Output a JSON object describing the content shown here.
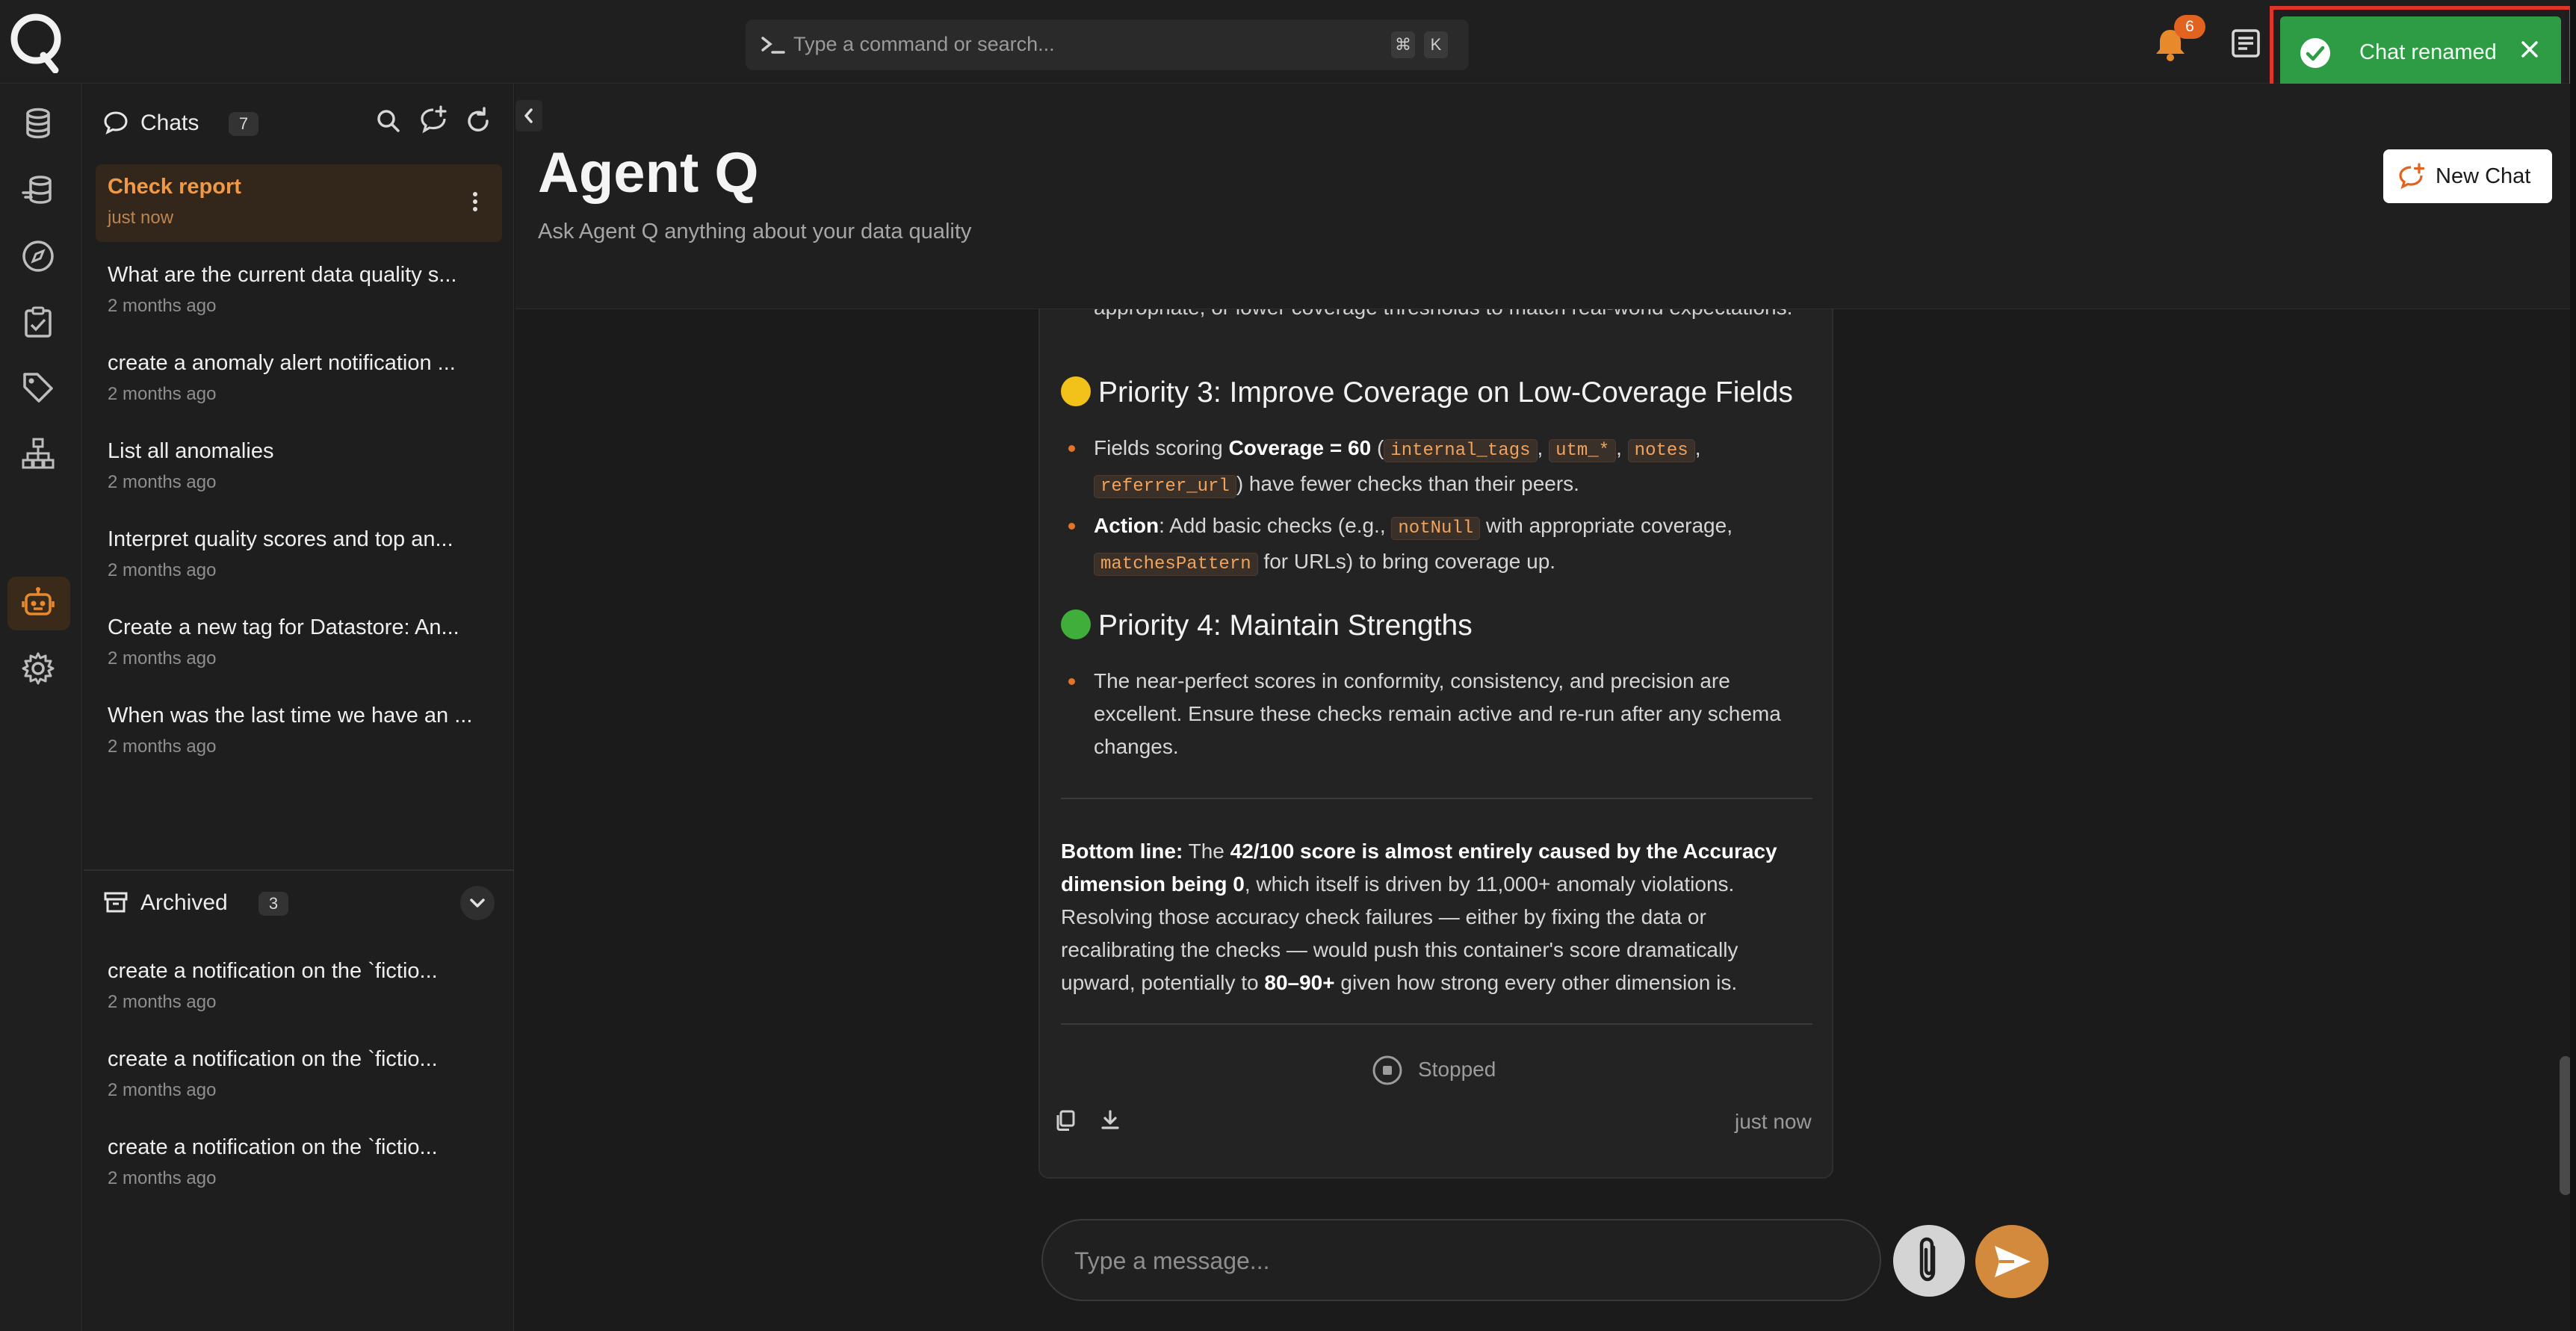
{
  "command_bar": {
    "placeholder": "Type a command or search...",
    "shortcut_mod": "⌘",
    "shortcut_key": "K"
  },
  "notifications": {
    "count": "6"
  },
  "toast": {
    "message": "Chat renamed",
    "color": "#2e9c45"
  },
  "sidebar_rail": {
    "items": [
      "database-icon",
      "datastore-icon",
      "explore-icon",
      "checks-icon",
      "tags-icon",
      "lineage-icon",
      "agent-icon",
      "settings-icon"
    ],
    "active": "agent-icon"
  },
  "chats": {
    "title": "Chats",
    "count": "7",
    "items": [
      {
        "title": "Check report",
        "time": "just now"
      },
      {
        "title": "What are the current data quality s...",
        "time": "2 months ago"
      },
      {
        "title": "create a anomaly alert notification ...",
        "time": "2 months ago"
      },
      {
        "title": "List all anomalies",
        "time": "2 months ago"
      },
      {
        "title": "Interpret quality scores and top an...",
        "time": "2 months ago"
      },
      {
        "title": "Create a new tag for Datastore: An...",
        "time": "2 months ago"
      },
      {
        "title": "When was the last time we have an ...",
        "time": "2 months ago"
      }
    ]
  },
  "archived": {
    "title": "Archived",
    "count": "3",
    "items": [
      {
        "title": "create a notification on the `fictio...",
        "time": "2 months ago"
      },
      {
        "title": "create a notification on the `fictio...",
        "time": "2 months ago"
      },
      {
        "title": "create a notification on the `fictio...",
        "time": "2 months ago"
      }
    ]
  },
  "header": {
    "title": "Agent Q",
    "subtitle": "Ask Agent Q anything about your data quality",
    "new_chat": "New Chat"
  },
  "message": {
    "clipped_top": "appropriate, or lower coverage thresholds to match real-world expectations.",
    "p3": {
      "title": "Priority 3: Improve Coverage on Low-Coverage Fields",
      "b1_a": "Fields scoring ",
      "b1_bold": "Coverage = 60",
      "b1_b": " (",
      "codes": [
        "internal_tags",
        "utm_*",
        "notes",
        "referrer_url"
      ],
      "b1_c": ") have fewer checks than their peers.",
      "b2_bold": "Action",
      "b2_a": ": Add basic checks (e.g., ",
      "b2_code1": "notNull",
      "b2_b": " with appropriate coverage, ",
      "b2_code2": "matchesPattern",
      "b2_c": " for URLs) to bring coverage up."
    },
    "p4": {
      "title": "Priority 4: Maintain Strengths",
      "b1": "The near-perfect scores in conformity, consistency, and precision are excellent. Ensure these checks remain active and re-run after any schema changes."
    },
    "bottom": {
      "label": "Bottom line:",
      "a": " The ",
      "bold1": "42/100 score is almost entirely caused by the Accuracy dimension being 0",
      "b": ", which itself is driven by 11,000+ anomaly violations. Resolving those accuracy check failures — either by fixing the data or recalibrating the checks — would push this container's score dramatically upward, potentially to ",
      "bold2": "80–90+",
      "c": " given how strong every other dimension is."
    },
    "status": "Stopped",
    "time": "just now"
  },
  "composer": {
    "placeholder": "Type a message..."
  }
}
